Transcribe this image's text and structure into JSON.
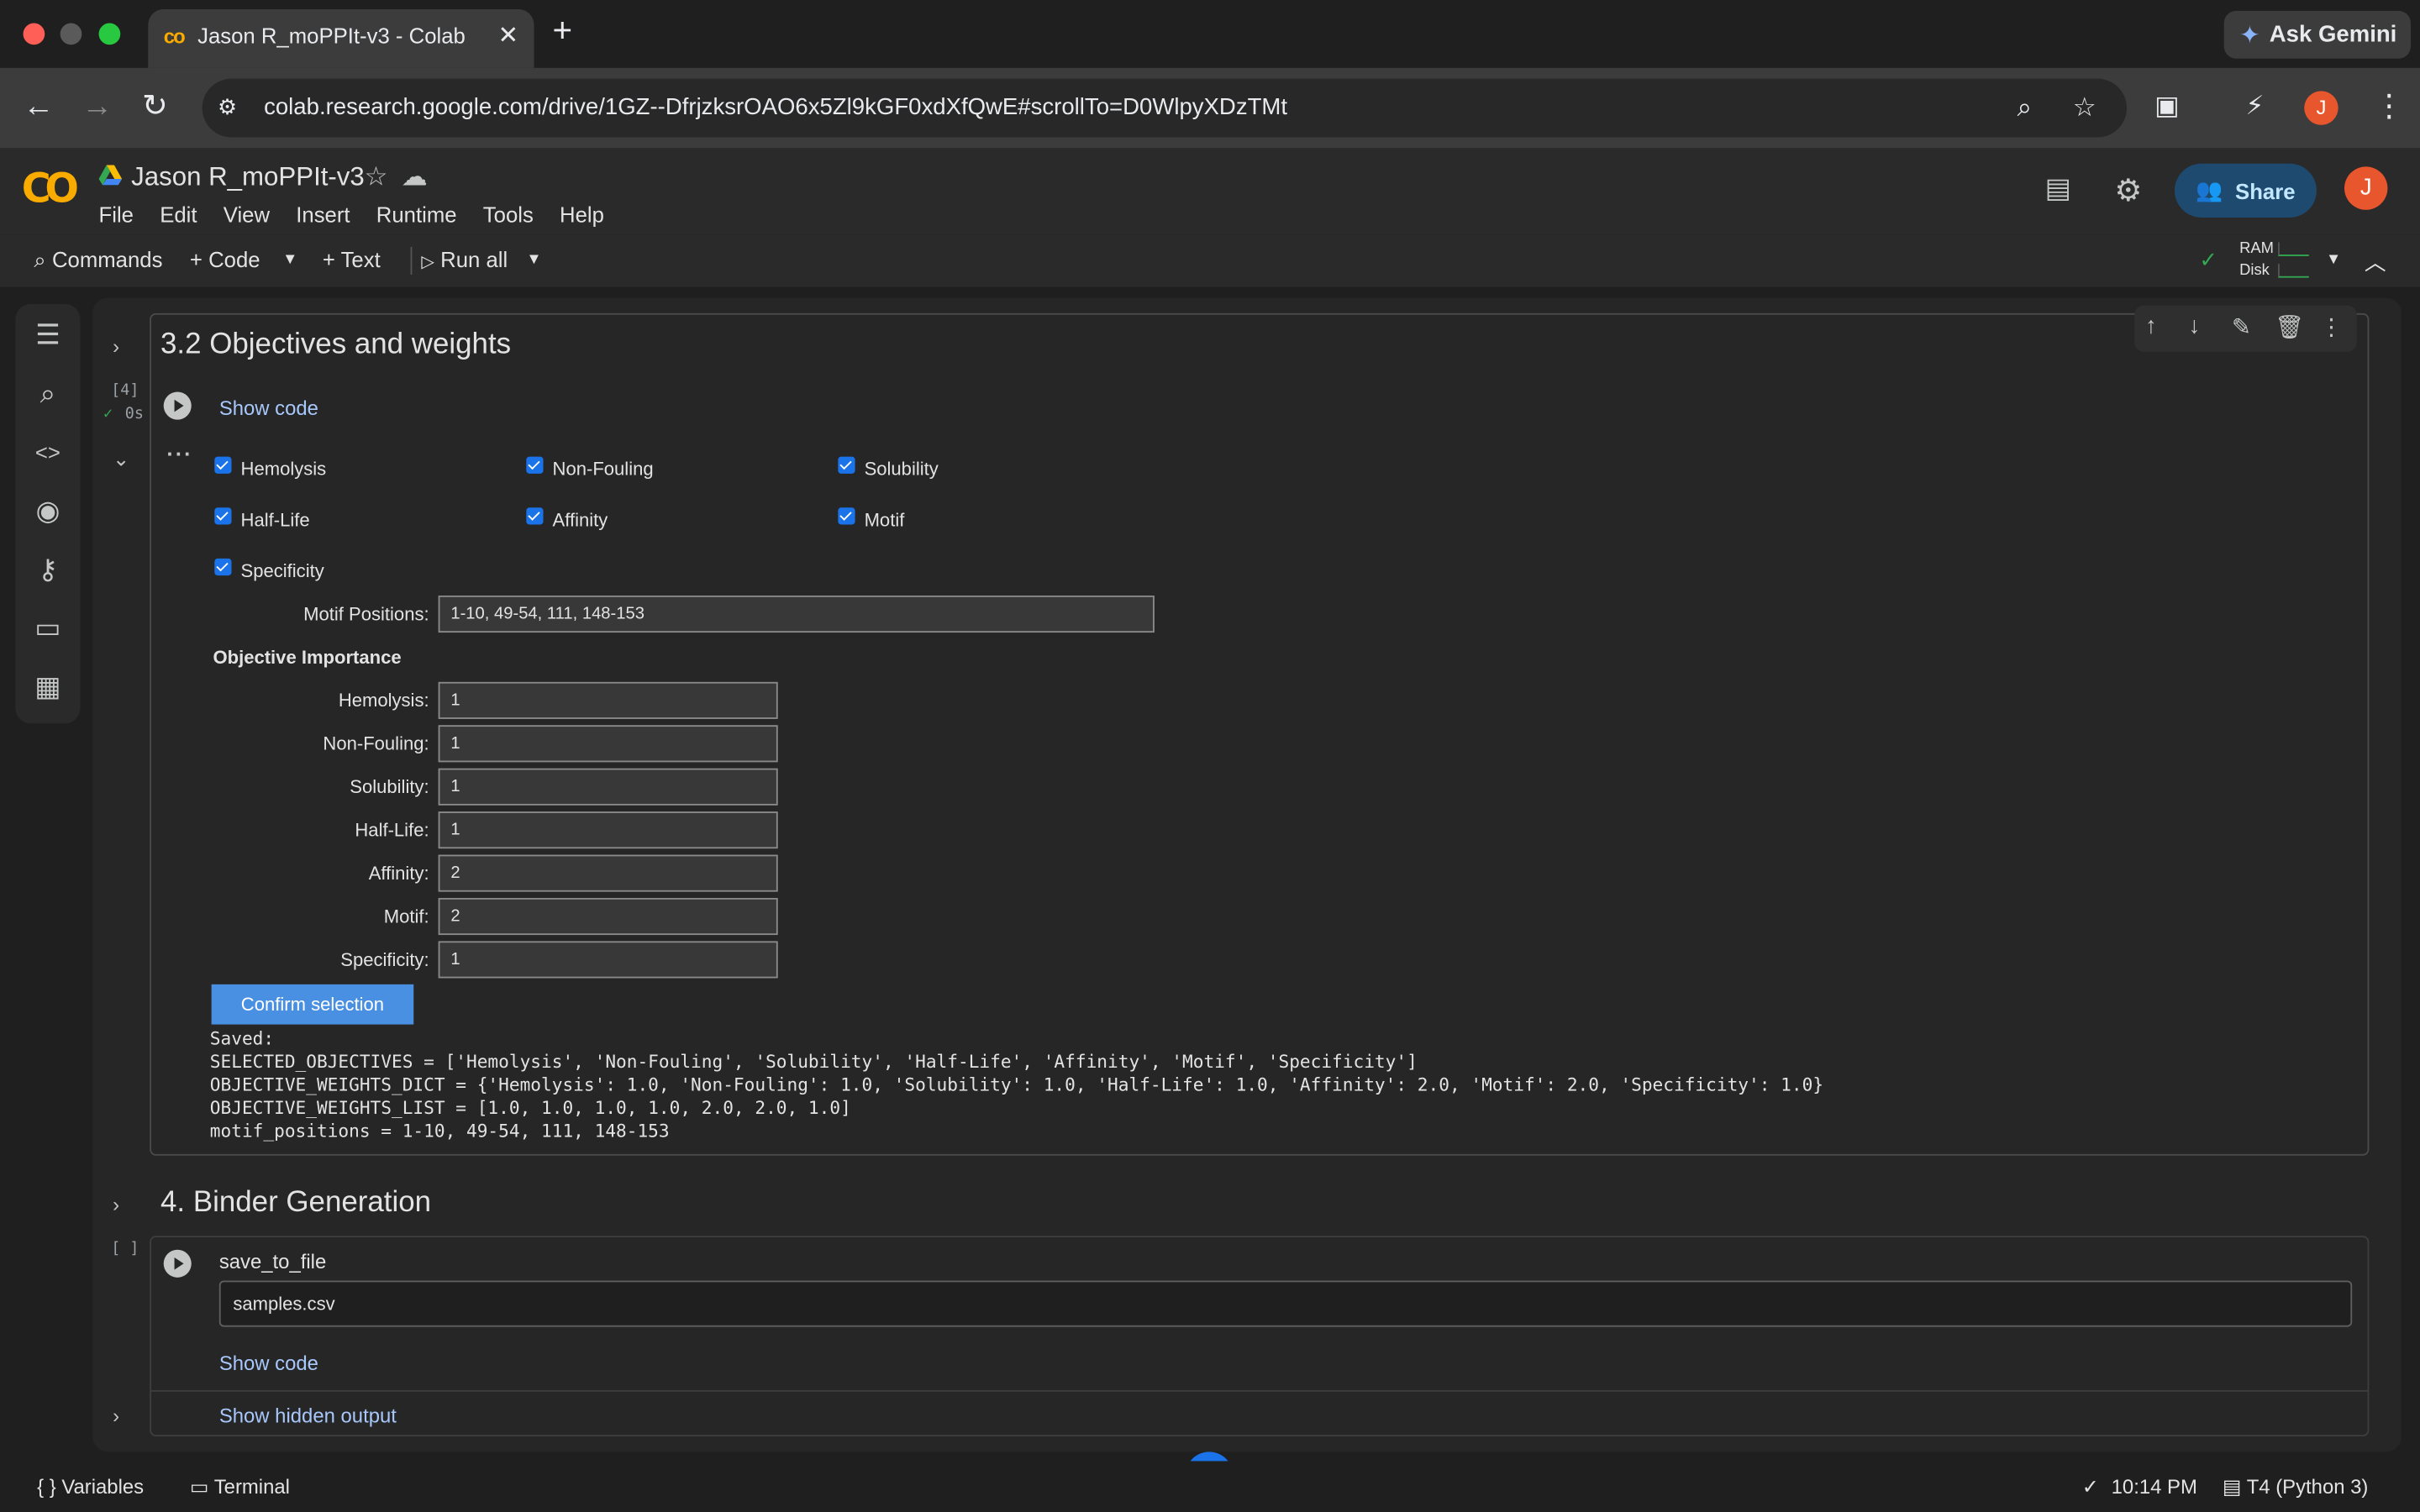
{
  "browser": {
    "tab_title": "Jason R_moPPIt-v3 - Colab",
    "tab_favicon": "co",
    "url": "colab.research.google.com/drive/1GZ--DfrjzksrOAO6x5Zl9kGF0xdXfQwE#scrollTo=D0WlpyXDzTMt",
    "ask_gemini": "Ask Gemini",
    "profile_initial": "J",
    "traffic_colors": [
      "#ff5f57",
      "#5a5a5a",
      "#28c840"
    ]
  },
  "colab": {
    "logo": "CO",
    "notebook_title": "Jason R_moPPIt-v3",
    "menu": [
      "File",
      "Edit",
      "View",
      "Insert",
      "Runtime",
      "Tools",
      "Help"
    ],
    "share_label": "Share",
    "avatar_initial": "J",
    "toolbar": {
      "commands": "Commands",
      "code": "+ Code",
      "text": "+ Text",
      "run_all": "Run all",
      "ram": "RAM",
      "disk": "Disk"
    }
  },
  "cell1": {
    "section_title": "3.2 Objectives and weights",
    "exec_count": "[4]",
    "exec_time": "0s",
    "show_code": "Show code",
    "checkboxes": [
      {
        "label": "Hemolysis",
        "checked": true
      },
      {
        "label": "Non-Fouling",
        "checked": true
      },
      {
        "label": "Solubility",
        "checked": true
      },
      {
        "label": "Half-Life",
        "checked": true
      },
      {
        "label": "Affinity",
        "checked": true
      },
      {
        "label": "Motif",
        "checked": true
      },
      {
        "label": "Specificity",
        "checked": true
      }
    ],
    "motif_positions_label": "Motif Positions:",
    "motif_positions_value": "1-10, 49-54, 111, 148-153",
    "objective_importance_heading": "Objective Importance",
    "weights": [
      {
        "label": "Hemolysis:",
        "value": "1"
      },
      {
        "label": "Non-Fouling:",
        "value": "1"
      },
      {
        "label": "Solubility:",
        "value": "1"
      },
      {
        "label": "Half-Life:",
        "value": "1"
      },
      {
        "label": "Affinity:",
        "value": "2"
      },
      {
        "label": "Motif:",
        "value": "2"
      },
      {
        "label": "Specificity:",
        "value": "1"
      }
    ],
    "confirm_label": "Confirm selection",
    "output_lines": [
      "Saved:",
      "SELECTED_OBJECTIVES = ['Hemolysis', 'Non-Fouling', 'Solubility', 'Half-Life', 'Affinity', 'Motif', 'Specificity']",
      "OBJECTIVE_WEIGHTS_DICT = {'Hemolysis': 1.0, 'Non-Fouling': 1.0, 'Solubility': 1.0, 'Half-Life': 1.0, 'Affinity': 2.0, 'Motif': 2.0, 'Specificity': 1.0}",
      "OBJECTIVE_WEIGHTS_LIST = [1.0, 1.0, 1.0, 1.0, 2.0, 2.0, 1.0]",
      "motif_positions = 1-10, 49-54, 111, 148-153"
    ]
  },
  "cell2": {
    "section_title": "4. Binder Generation",
    "exec_count": "[ ]",
    "param_label": "save_to_file",
    "param_value": "samples.csv",
    "show_code": "Show code",
    "show_hidden_output": "Show hidden output"
  },
  "statusbar": {
    "variables": "Variables",
    "terminal": "Terminal",
    "time": "10:14 PM",
    "runtime": "T4 (Python 3)"
  }
}
